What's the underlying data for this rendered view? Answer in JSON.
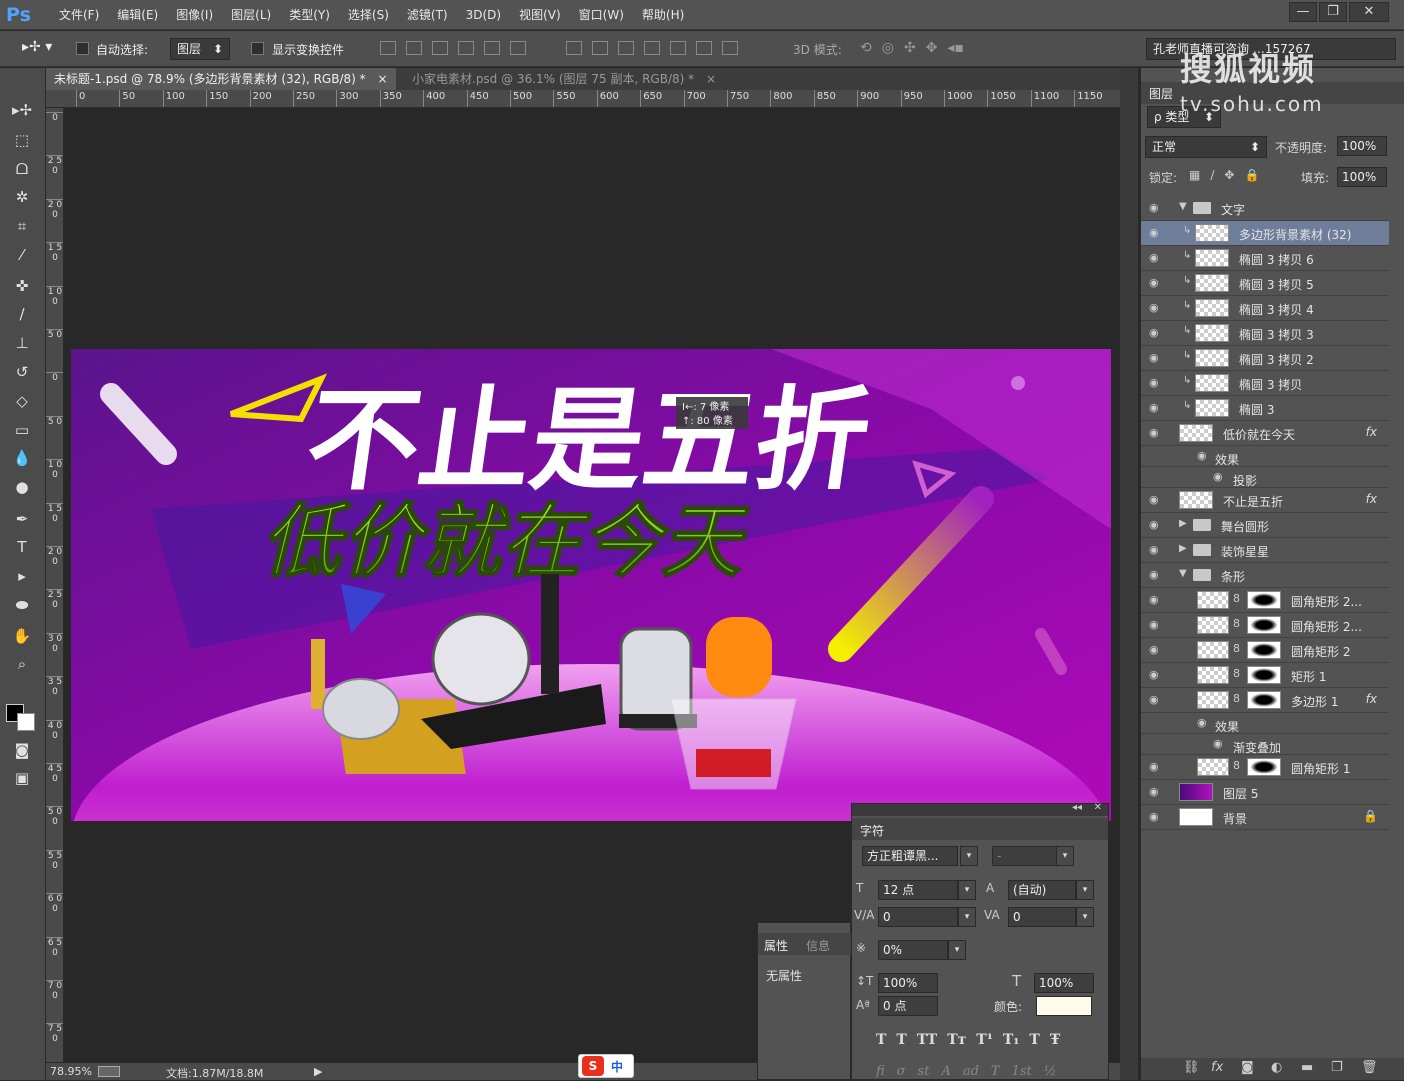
{
  "app": {
    "logo": "Ps",
    "win_min": "—",
    "win_max": "❐",
    "win_close": "✕"
  },
  "menu": [
    "文件(F)",
    "编辑(E)",
    "图像(I)",
    "图层(L)",
    "类型(Y)",
    "选择(S)",
    "滤镜(T)",
    "3D(D)",
    "视图(V)",
    "窗口(W)",
    "帮助(H)"
  ],
  "options": {
    "auto_select_label": "自动选择:",
    "auto_select_value": "图层",
    "show_transform_label": "显示变换控件",
    "mode_3d_label": "3D 模式:",
    "workspace_text": "孔老师直播可咨询 …157267"
  },
  "tabs": [
    {
      "label": "未标题-1.psd @ 78.9% (多边形背景素材 (32), RGB/8) *",
      "close": "×"
    },
    {
      "label": "小家电素材.psd @ 36.1% (图层 75 副本, RGB/8) *",
      "close": "×"
    }
  ],
  "ruler_h": [
    "0",
    "50",
    "100",
    "150",
    "200",
    "250",
    "300",
    "350",
    "400",
    "450",
    "500",
    "550",
    "600",
    "650",
    "700",
    "750",
    "800",
    "850",
    "900",
    "950",
    "1000",
    "1050",
    "1100",
    "1150"
  ],
  "ruler_v": [
    "0",
    "2 5 0",
    "2 0 0",
    "1 5 0",
    "1 0 0",
    "5 0",
    "0",
    "5 0",
    "1 0 0",
    "1 5 0",
    "2 0 0",
    "2 5 0",
    "3 0 0",
    "3 5 0",
    "4 0 0",
    "4 5 0",
    "5 0 0",
    "5 5 0",
    "6 0 0",
    "6 5 0",
    "7 0 0",
    "7 5 0",
    "8"
  ],
  "canvas": {
    "headline": "不止是五折",
    "subline": "低价就在今天",
    "tooltip_line1": "I←: 7 像素",
    "tooltip_line2": "↑: 80 像素"
  },
  "status": {
    "zoom": "78.95%",
    "doc": "文档:1.87M/18.8M"
  },
  "watermark": {
    "line1": "搜狐视频",
    "line2": "tv.sohu.com"
  },
  "layers_panel": {
    "title": "图层",
    "filter_label": "ρ 类型",
    "blend_mode": "正常",
    "opacity_label": "不透明度:",
    "opacity_value": "100%",
    "lock_label": "锁定:",
    "fill_label": "填充:",
    "fill_value": "100%",
    "rows": [
      {
        "name": "文字",
        "type": "group-open"
      },
      {
        "name": "多边形背景素材 (32)",
        "type": "layer",
        "selected": true
      },
      {
        "name": "椭圆 3 拷贝 6",
        "type": "layer"
      },
      {
        "name": "椭圆 3 拷贝 5",
        "type": "layer"
      },
      {
        "name": "椭圆 3 拷贝 4",
        "type": "layer"
      },
      {
        "name": "椭圆 3 拷贝 3",
        "type": "layer"
      },
      {
        "name": "椭圆 3 拷贝 2",
        "type": "layer"
      },
      {
        "name": "椭圆 3 拷贝",
        "type": "layer"
      },
      {
        "name": "椭圆 3",
        "type": "layer"
      },
      {
        "name": "低价就在今天",
        "type": "text-fx"
      },
      {
        "name": "效果",
        "type": "effect"
      },
      {
        "name": "投影",
        "type": "subeffect"
      },
      {
        "name": "不止是五折",
        "type": "text-fx"
      },
      {
        "name": "舞台圆形",
        "type": "group-closed"
      },
      {
        "name": "装饰星星",
        "type": "group-closed"
      },
      {
        "name": "条形",
        "type": "group-open"
      },
      {
        "name": "圆角矩形 2...",
        "type": "masked"
      },
      {
        "name": "圆角矩形 2...",
        "type": "masked"
      },
      {
        "name": "圆角矩形 2",
        "type": "masked"
      },
      {
        "name": "矩形 1",
        "type": "masked"
      },
      {
        "name": "多边形 1",
        "type": "masked-fx"
      },
      {
        "name": "效果",
        "type": "effect"
      },
      {
        "name": "渐变叠加",
        "type": "subeffect"
      },
      {
        "name": "圆角矩形 1",
        "type": "masked"
      },
      {
        "name": "图层 5",
        "type": "purple"
      },
      {
        "name": "背景",
        "type": "background"
      }
    ],
    "fx": "fx"
  },
  "char_panel": {
    "title": "字符",
    "font": "方正粗谭黑...",
    "style": "-",
    "size": "12 点",
    "leading": "(自动)",
    "kerning": "0",
    "tracking": "0",
    "tsume": "0%",
    "vscale": "100%",
    "hscale": "100%",
    "baseline": "0 点",
    "color_label": "颜色:",
    "styles": [
      "T",
      "T",
      "TT",
      "Tт",
      "T¹",
      "T₁",
      "T",
      "Ŧ"
    ],
    "ot": [
      "fi",
      "σ",
      "st",
      "A",
      "ad",
      "T",
      "1st",
      "½"
    ]
  },
  "prop_panel": {
    "tab1": "属性",
    "tab2": "信息",
    "content": "无属性"
  },
  "ime": {
    "label": "中"
  }
}
